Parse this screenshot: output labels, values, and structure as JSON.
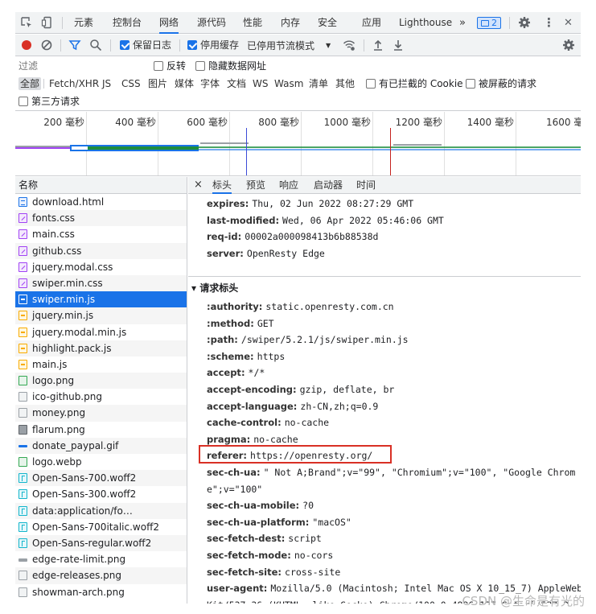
{
  "panel_tabs": {
    "elements": "元素",
    "console": "控制台",
    "network": "网络",
    "sources": "源代码",
    "performance": "性能",
    "memory": "内存",
    "security": "安全",
    "application": "应用",
    "lighthouse": "Lighthouse",
    "more": "»",
    "issues_count": "2",
    "kebab": "⋮",
    "close": "✕"
  },
  "toolbar": {
    "preserve_log": "保留日志",
    "disable_cache": "停用缓存",
    "throttling": "已停用节流模式",
    "throttling_arrow": "▼"
  },
  "filter": {
    "placeholder": "过滤",
    "invert": "反转",
    "hide_data_urls": "隐藏数据网址"
  },
  "resource_types": {
    "all": "全部",
    "fetch_xhr": "Fetch/XHR",
    "js": "JS",
    "css": "CSS",
    "img": "图片",
    "media": "媒体",
    "font": "字体",
    "doc": "文档",
    "ws": "WS",
    "wasm": "Wasm",
    "manifest": "清单",
    "other": "其他",
    "blocked_cookies": "有已拦截的 Cookie",
    "blocked_requests": "被屏蔽的请求",
    "third_party": "第三方请求"
  },
  "overview": {
    "ticks": [
      "200 毫秒",
      "400 毫秒",
      "600 毫秒",
      "800 毫秒",
      "1000 毫秒",
      "1200 毫秒",
      "1400 毫秒",
      "1600 毫"
    ]
  },
  "requests": {
    "name_header": "名称",
    "selected_index": 7,
    "files": [
      {
        "name": "download.html",
        "type": "doc"
      },
      {
        "name": "fonts.css",
        "type": "css"
      },
      {
        "name": "main.css",
        "type": "css"
      },
      {
        "name": "github.css",
        "type": "css"
      },
      {
        "name": "jquery.modal.css",
        "type": "css"
      },
      {
        "name": "swiper.min.css",
        "type": "css"
      },
      {
        "name": "swiper.min.js",
        "type": "jssel"
      },
      {
        "name": "jquery.min.js",
        "type": "js"
      },
      {
        "name": "jquery.modal.min.js",
        "type": "js"
      },
      {
        "name": "highlight.pack.js",
        "type": "js"
      },
      {
        "name": "main.js",
        "type": "js"
      },
      {
        "name": "logo.png",
        "type": "img"
      },
      {
        "name": "ico-github.png",
        "type": "imggray"
      },
      {
        "name": "money.png",
        "type": "imggray"
      },
      {
        "name": "flarum.png",
        "type": "imgdark"
      },
      {
        "name": "donate_paypal.gif",
        "type": "gifline"
      },
      {
        "name": "logo.webp",
        "type": "img"
      },
      {
        "name": "Open-Sans-700.woff2",
        "type": "font"
      },
      {
        "name": "Open-Sans-300.woff2",
        "type": "font"
      },
      {
        "name": "data:application/fo…",
        "type": "font"
      },
      {
        "name": "Open-Sans-700italic.woff2",
        "type": "font"
      },
      {
        "name": "Open-Sans-regular.woff2",
        "type": "font"
      },
      {
        "name": "edge-rate-limit.png",
        "type": "grayline"
      },
      {
        "name": "edge-releases.png",
        "type": "imggray"
      },
      {
        "name": "showman-arch.png",
        "type": "imggray"
      }
    ]
  },
  "detail_tabs": {
    "close": "×",
    "headers": "标头",
    "preview": "预览",
    "response": "响应",
    "initiator": "启动器",
    "timing": "时间"
  },
  "response_headers": [
    {
      "name": "expires",
      "value": "Thu, 02 Jun 2022 08:27:29 GMT"
    },
    {
      "name": "last-modified",
      "value": "Wed, 06 Apr 2022 05:46:06 GMT"
    },
    {
      "name": "req-id",
      "value": "00002a000098413b6b88538d"
    },
    {
      "name": "server",
      "value": "OpenResty Edge"
    }
  ],
  "request_headers_title": "▾ 请求标头",
  "request_headers": [
    {
      "name": ":authority",
      "value": "static.openresty.com.cn"
    },
    {
      "name": ":method",
      "value": "GET"
    },
    {
      "name": ":path",
      "value": "/swiper/5.2.1/js/swiper.min.js"
    },
    {
      "name": ":scheme",
      "value": "https"
    },
    {
      "name": "accept",
      "value": "*/*"
    },
    {
      "name": "accept-encoding",
      "value": "gzip, deflate, br"
    },
    {
      "name": "accept-language",
      "value": "zh-CN,zh;q=0.9"
    },
    {
      "name": "cache-control",
      "value": "no-cache"
    },
    {
      "name": "pragma",
      "value": "no-cache"
    },
    {
      "name": "referer",
      "value": "https://openresty.org/"
    },
    {
      "name": "sec-ch-ua",
      "value": "\" Not A;Brand\";v=\"99\", \"Chromium\";v=\"100\", \"Google Chrom"
    },
    {
      "name": "",
      "value": "e\";v=\"100\""
    },
    {
      "name": "sec-ch-ua-mobile",
      "value": "?0"
    },
    {
      "name": "sec-ch-ua-platform",
      "value": "\"macOS\""
    },
    {
      "name": "sec-fetch-dest",
      "value": "script"
    },
    {
      "name": "sec-fetch-mode",
      "value": "no-cors"
    },
    {
      "name": "sec-fetch-site",
      "value": "cross-site"
    },
    {
      "name": "user-agent",
      "value": "Mozilla/5.0 (Macintosh; Intel Mac OS X 10_15_7) AppleWeb"
    },
    {
      "name": "",
      "value": "Kit/537.36 (KHTML, like Gecko) Chrome/100.0.4896.127 Safari/537.3"
    }
  ],
  "watermark": "CSDN @生命是有光的",
  "colors": {
    "accent": "#1a73e8",
    "record": "#d93025",
    "highlight_box": "#d93025"
  }
}
